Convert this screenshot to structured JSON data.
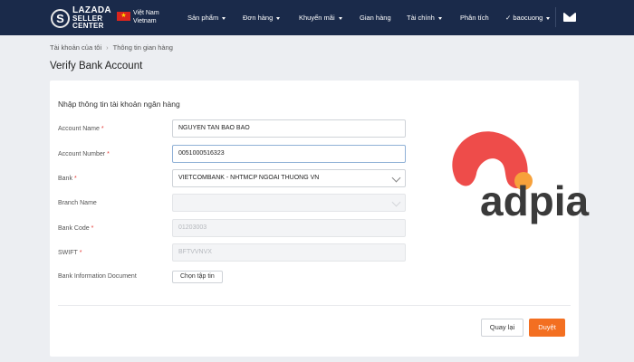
{
  "header": {
    "logo": {
      "mark": "S",
      "line1": "LAZADA",
      "line2": "SELLER",
      "line3": "CENTER"
    },
    "flag_glyph": "★",
    "region": {
      "line1": "Việt Nam",
      "line2": "Vietnam"
    },
    "nav": [
      {
        "label": "Sản phẩm"
      },
      {
        "label": "Đơn hàng"
      },
      {
        "label": "Khuyến mãi"
      },
      {
        "label": "Gian hàng"
      },
      {
        "label": "Tài chính"
      },
      {
        "label": "Phân tích"
      }
    ],
    "user": {
      "check": "✓",
      "name": "baocuong"
    }
  },
  "breadcrumb": {
    "root": "Tài khoản của tôi",
    "separator": "›",
    "current": "Thông tin gian hàng"
  },
  "page_title": "Verify Bank Account",
  "form": {
    "section_title": "Nhập thông tin tài khoản ngân hàng",
    "required_mark": "*",
    "fields": {
      "account_name": {
        "label": "Account Name",
        "value": "NGUYEN TAN BAO BAO"
      },
      "account_number": {
        "label": "Account Number",
        "value": "0051000516323"
      },
      "bank": {
        "label": "Bank",
        "value": "VIETCOMBANK - NHTMCP NGOAI THUONG VN"
      },
      "branch_name": {
        "label": "Branch Name",
        "value": ""
      },
      "bank_code": {
        "label": "Bank Code",
        "value": "01203003"
      },
      "swift": {
        "label": "SWIFT",
        "value": "BFTVVNVX"
      },
      "bank_doc": {
        "label": "Bank Information Document",
        "button": "Chọn tập tin"
      }
    },
    "buttons": {
      "back": "Quay lại",
      "submit": "Duyệt"
    }
  },
  "watermark": {
    "text": "adpia",
    "colors": {
      "primary": "#ee4c4a",
      "secondary": "#f7a13b",
      "text": "#3a3a3a"
    }
  },
  "colors": {
    "nav_bg": "#1a2a4a",
    "accent": "#f36f21",
    "required": "#e53935"
  }
}
